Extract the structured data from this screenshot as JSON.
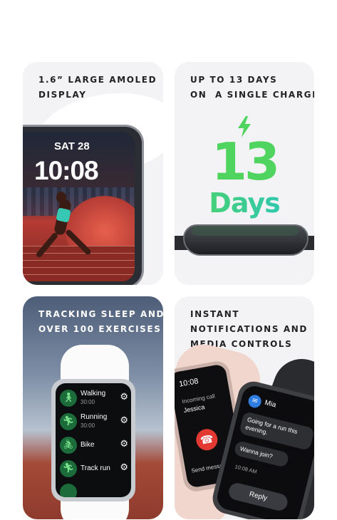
{
  "cards": [
    {
      "caption": [
        "1.6” LARGE AMOLED",
        "DISPLAY"
      ],
      "watch": {
        "date": "SAT 28",
        "time": "10:08"
      }
    },
    {
      "caption": [
        "UP TO 13 DAYS",
        "ON  A SINGLE CHARGE"
      ],
      "big_number": "13",
      "unit": "Days"
    },
    {
      "caption": [
        "TRACKING SLEEP AND",
        "OVER 100 EXERCISES"
      ],
      "exercises": [
        {
          "name": "Walking",
          "sub": "30:00",
          "icon": "walking-icon"
        },
        {
          "name": "Running",
          "sub": "30:00",
          "icon": "running-icon"
        },
        {
          "name": "Bike",
          "sub": "",
          "icon": "bike-icon"
        },
        {
          "name": "Track run",
          "sub": "",
          "icon": "track-run-icon"
        }
      ]
    },
    {
      "caption": [
        "INSTANT",
        "NOTIFICATIONS AND",
        "MEDIA CONTROLS"
      ],
      "call": {
        "time": "10:08",
        "label": "Incoming call",
        "name": "Jessica",
        "send": "Send messa"
      },
      "message": {
        "sender": "Mia",
        "text1": "Going for a run this evening.",
        "text2": "Wanna join?",
        "time": "10:08 AM",
        "reply": "Reply"
      }
    }
  ],
  "colors": {
    "green": "#4fd45f",
    "teal": "#28c4c6",
    "decline": "#e23a32"
  }
}
